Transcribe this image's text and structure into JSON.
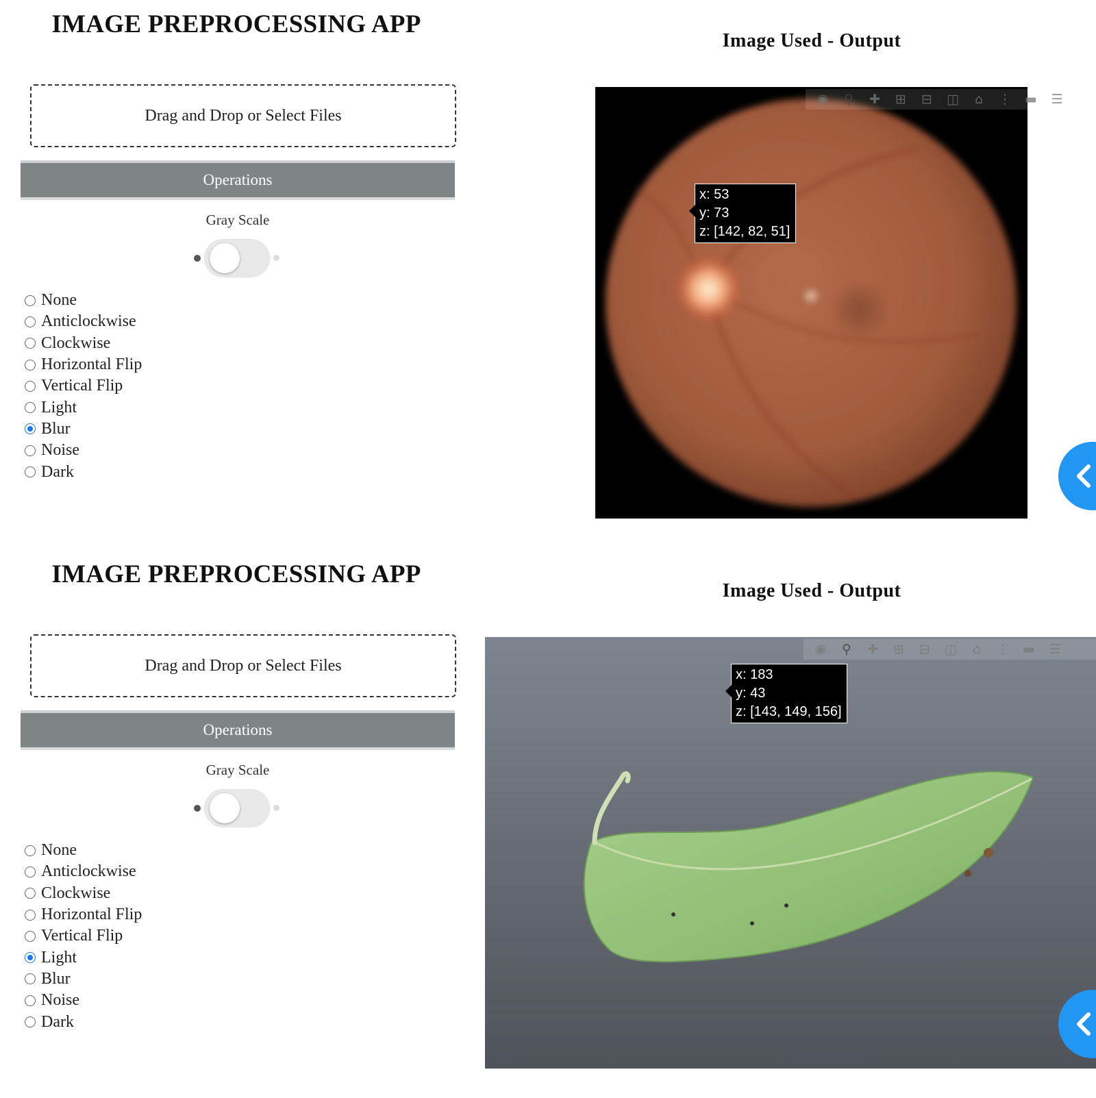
{
  "panels": [
    {
      "app_title": "IMAGE PREPROCESSING APP",
      "upload_label": "Drag and Drop or Select Files",
      "operations_label": "Operations",
      "gray_scale_label": "Gray Scale",
      "gray_scale_on": false,
      "radio_options": [
        "None",
        "Anticlockwise",
        "Clockwise",
        "Horizontal Flip",
        "Vertical Flip",
        "Light",
        "Blur",
        "Noise",
        "Dark"
      ],
      "selected_option": "Blur",
      "output_title": "Image Used - Output",
      "image_subject": "retinal fundus photograph",
      "hover": {
        "x": "x: 53",
        "y": "y: 73",
        "z": "z: [142, 82, 51]"
      }
    },
    {
      "app_title": "IMAGE PREPROCESSING APP",
      "upload_label": "Drag and Drop or Select Files",
      "operations_label": "Operations",
      "gray_scale_label": "Gray Scale",
      "gray_scale_on": false,
      "radio_options": [
        "None",
        "Anticlockwise",
        "Clockwise",
        "Horizontal Flip",
        "Vertical Flip",
        "Light",
        "Blur",
        "Noise",
        "Dark"
      ],
      "selected_option": "Light",
      "output_title": "Image Used - Output",
      "image_subject": "green leaf on grey surface",
      "hover": {
        "x": "x: 183",
        "y": "y: 43",
        "z": "z: [143, 149, 156]"
      }
    }
  ],
  "modebar_icons": [
    "camera-icon",
    "zoom-icon",
    "pan-icon",
    "zoom-in-icon",
    "zoom-out-icon",
    "autoscale-icon",
    "reset-axes-icon",
    "spike-lines-icon",
    "hover-closest-icon",
    "hover-compare-icon"
  ],
  "colors": {
    "operations_bar": "#7f8487",
    "radio_checked": "#1a73e8",
    "collapse_button": "#2196f3"
  }
}
